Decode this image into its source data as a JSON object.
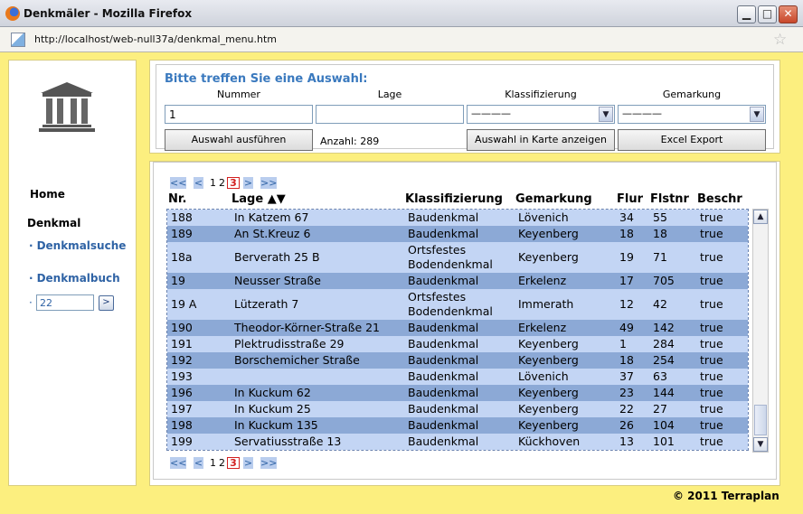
{
  "window": {
    "title": "Denkmäler - Mozilla Firefox",
    "minimize": "▁",
    "maximize": "□",
    "close": "✕"
  },
  "address": {
    "url": "http://localhost/web-null37a/denkmal_menu.htm"
  },
  "icons": {
    "browser": "firefox-icon",
    "page": "page-icon",
    "bookmark": "star-icon",
    "logo": "temple-icon"
  },
  "sidebar": {
    "home": "Home",
    "section": "Denkmal",
    "links": [
      {
        "dot": "·",
        "label": "Denkmalsuche"
      },
      {
        "dot": "·",
        "label": "Denkmalbuch"
      }
    ],
    "page_jump": {
      "dot": "·",
      "value": "22",
      "button": ">"
    }
  },
  "search": {
    "title": "Bitte treffen Sie eine Auswahl:",
    "labels": {
      "nummer": "Nummer",
      "lage": "Lage",
      "klassifizierung": "Klassifizierung",
      "gemarkung": "Gemarkung"
    },
    "values": {
      "nummer": "1",
      "lage": ""
    },
    "klassifizierung_selected": "————",
    "gemarkung_selected": "————",
    "run_button": "Auswahl ausführen",
    "count": "Anzahl: 289",
    "map_button": "Auswahl in Karte anzeigen",
    "excel_button": "Excel Export"
  },
  "pager": {
    "first": "<<",
    "prev": "<",
    "pages": [
      "1",
      "2"
    ],
    "current": "3",
    "next": ">",
    "last": ">>"
  },
  "table": {
    "headers": [
      "Nr.",
      "Lage ▲▼",
      "Klassifizierung",
      "Gemarkung",
      "Flur",
      "Flstnr",
      "Beschr"
    ],
    "rows": [
      {
        "nr": "188",
        "lage": "In Katzem 67",
        "klass": "Baudenkmal",
        "klass2": "",
        "gem": "Lövenich",
        "flur": "34",
        "flst": "55",
        "beschr": "true"
      },
      {
        "nr": "189",
        "lage": "An St.Kreuz 6",
        "klass": "Baudenkmal",
        "klass2": "",
        "gem": "Keyenberg",
        "flur": "18",
        "flst": "18",
        "beschr": "true"
      },
      {
        "nr": "18a",
        "lage": "Berverath 25 B",
        "klass": "Ortsfestes",
        "klass2": "Bodendenkmal",
        "gem": "Keyenberg",
        "flur": "19",
        "flst": "71",
        "beschr": "true"
      },
      {
        "nr": "19",
        "lage": "Neusser Straße",
        "klass": "Baudenkmal",
        "klass2": "",
        "gem": "Erkelenz",
        "flur": "17",
        "flst": "705",
        "beschr": "true"
      },
      {
        "nr": "19 A",
        "lage": "Lützerath 7",
        "klass": "Ortsfestes",
        "klass2": "Bodendenkmal",
        "gem": "Immerath",
        "flur": "12",
        "flst": "42",
        "beschr": "true"
      },
      {
        "nr": "190",
        "lage": "Theodor-Körner-Straße 21",
        "klass": "Baudenkmal",
        "klass2": "",
        "gem": "Erkelenz",
        "flur": "49",
        "flst": "142",
        "beschr": "true"
      },
      {
        "nr": "191",
        "lage": "Plektrudisstraße 29",
        "klass": "Baudenkmal",
        "klass2": "",
        "gem": "Keyenberg",
        "flur": "1",
        "flst": "284",
        "beschr": "true"
      },
      {
        "nr": "192",
        "lage": "Borschemicher Straße",
        "klass": "Baudenkmal",
        "klass2": "",
        "gem": "Keyenberg",
        "flur": "18",
        "flst": "254",
        "beschr": "true"
      },
      {
        "nr": "193",
        "lage": "",
        "klass": "Baudenkmal",
        "klass2": "",
        "gem": "Lövenich",
        "flur": "37",
        "flst": "63",
        "beschr": "true"
      },
      {
        "nr": "196",
        "lage": "In Kuckum 62",
        "klass": "Baudenkmal",
        "klass2": "",
        "gem": "Keyenberg",
        "flur": "23",
        "flst": "144",
        "beschr": "true"
      },
      {
        "nr": "197",
        "lage": "In Kuckum 25",
        "klass": "Baudenkmal",
        "klass2": "",
        "gem": "Keyenberg",
        "flur": "22",
        "flst": "27",
        "beschr": "true"
      },
      {
        "nr": "198",
        "lage": "In Kuckum 135",
        "klass": "Baudenkmal",
        "klass2": "",
        "gem": "Keyenberg",
        "flur": "26",
        "flst": "104",
        "beschr": "true"
      },
      {
        "nr": "199",
        "lage": "Servatiusstraße 13",
        "klass": "Baudenkmal",
        "klass2": "",
        "gem": "Kückhoven",
        "flur": "13",
        "flst": "101",
        "beschr": "true"
      }
    ]
  },
  "scrollbar": {
    "up": "▲",
    "down": "▼"
  },
  "footer": {
    "copyright": "© 2011 Terraplan"
  },
  "colors": {
    "page_bg": "#fcef7f",
    "row_dark": "#8ca9d6",
    "row_light": "#c3d5f4",
    "accent": "#3a79be",
    "current_page": "#d32020"
  }
}
